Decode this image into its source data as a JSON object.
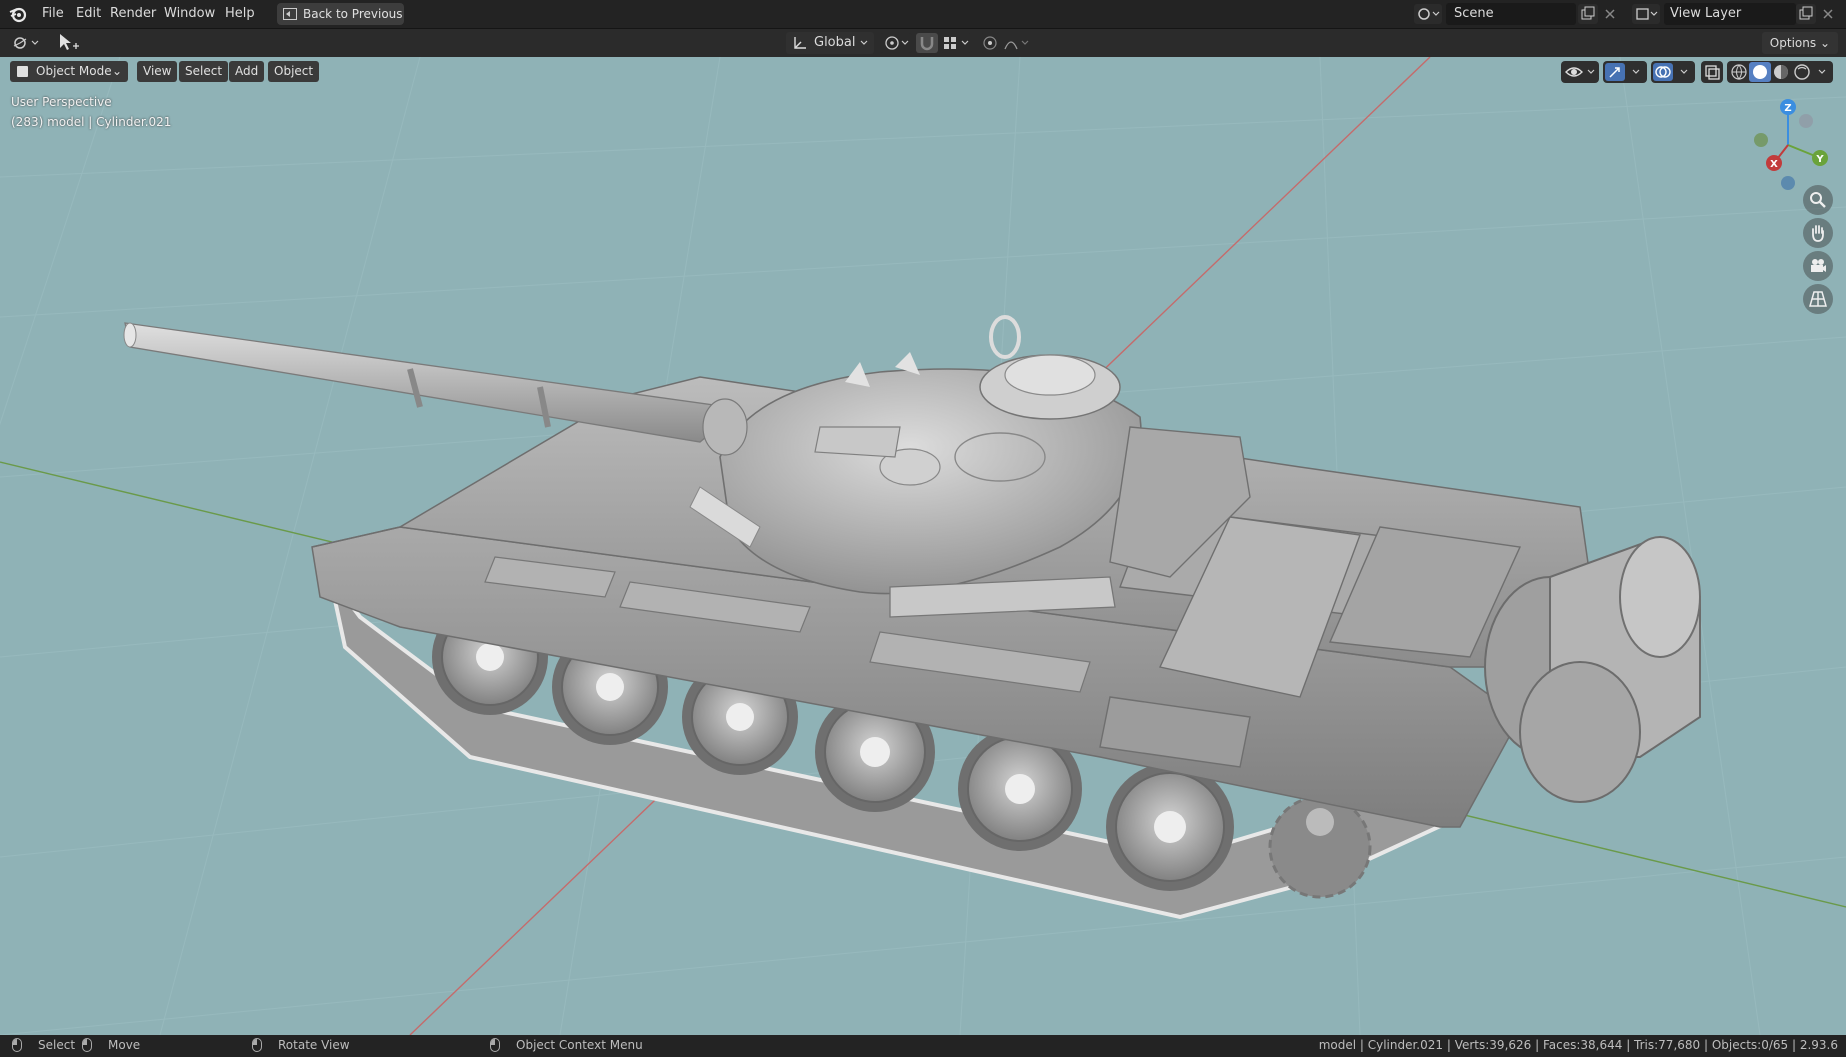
{
  "menu": {
    "items": [
      "File",
      "Edit",
      "Render",
      "Window",
      "Help"
    ],
    "back_label": "Back to Previous"
  },
  "scene": {
    "name": "Scene"
  },
  "view_layer": {
    "name": "View Layer"
  },
  "toolbar": {
    "transform_orientation": "Global",
    "options_label": "Options"
  },
  "viewport": {
    "mode": "Object Mode",
    "menus": [
      "View",
      "Select",
      "Add",
      "Object"
    ],
    "perspective_label": "User Perspective",
    "object_label": "(283) model | Cylinder.021",
    "background": "#8fb2b6",
    "gizmo": {
      "x": "X",
      "y": "Y",
      "z": "Z"
    }
  },
  "statusbar": {
    "select": "Select",
    "move": "Move",
    "rotate": "Rotate View",
    "context_menu": "Object Context Menu",
    "stats": "model | Cylinder.021 | Verts:39,626 | Faces:38,644 | Tris:77,680 | Objects:0/65 | 2.93.6"
  },
  "colors": {
    "x_axis": "#c23b3b",
    "y_axis": "#6aa33a",
    "z_axis": "#3b8ee0",
    "viewport_bg": "#8fb2b6"
  }
}
